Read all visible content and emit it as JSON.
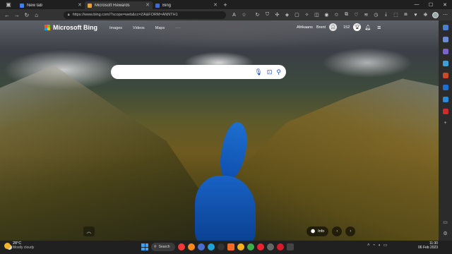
{
  "browser": {
    "tabs": [
      {
        "title": "New tab",
        "favicon_color": "#3b82f6",
        "active": false
      },
      {
        "title": "Microsoft Rewards",
        "favicon_color": "#e8a33d",
        "active": true
      },
      {
        "title": "Bing",
        "favicon_color": "#3f6bd8",
        "active": false
      }
    ],
    "new_tab_label": "+",
    "address": {
      "url": "https://www.bing.com/?scope=web&cc=ZA&FORM=ANNTH1"
    }
  },
  "bing": {
    "brand": "Microsoft Bing",
    "nav": [
      "Images",
      "Videos",
      "Maps",
      "···"
    ],
    "language": "Afrikaans",
    "user_name": "Brent",
    "rewards_points": "152",
    "search": {
      "value": "",
      "placeholder": ""
    },
    "info_label": "Info"
  },
  "taskbar": {
    "temperature": "28°C",
    "condition": "Mostly cloudy",
    "search_label": "Search",
    "time": "11:30",
    "date": "06 Feb 2023"
  },
  "colors": {
    "accent": "#1d4fb0",
    "tab_strip": "#1f1f1f",
    "toolbar": "#333333",
    "taskbar": "#202020"
  },
  "icons": {
    "sidebar": [
      "search-icon",
      "shopping-icon",
      "tools-icon",
      "games-icon",
      "office-icon",
      "outlook-icon",
      "drop-icon",
      "pinterest-icon",
      "add-icon",
      "layout-icon",
      "settings-icon"
    ],
    "taskbar_apps": [
      "start-icon",
      "search-icon",
      "vivaldi-icon",
      "firefox-icon",
      "edge-dev-icon",
      "edge-icon",
      "spotify-icon",
      "brave-icon",
      "chrome-canary-icon",
      "chrome-icon",
      "opera-icon",
      "chrome-dev-icon",
      "opera-gx-icon",
      "app-icon"
    ]
  }
}
